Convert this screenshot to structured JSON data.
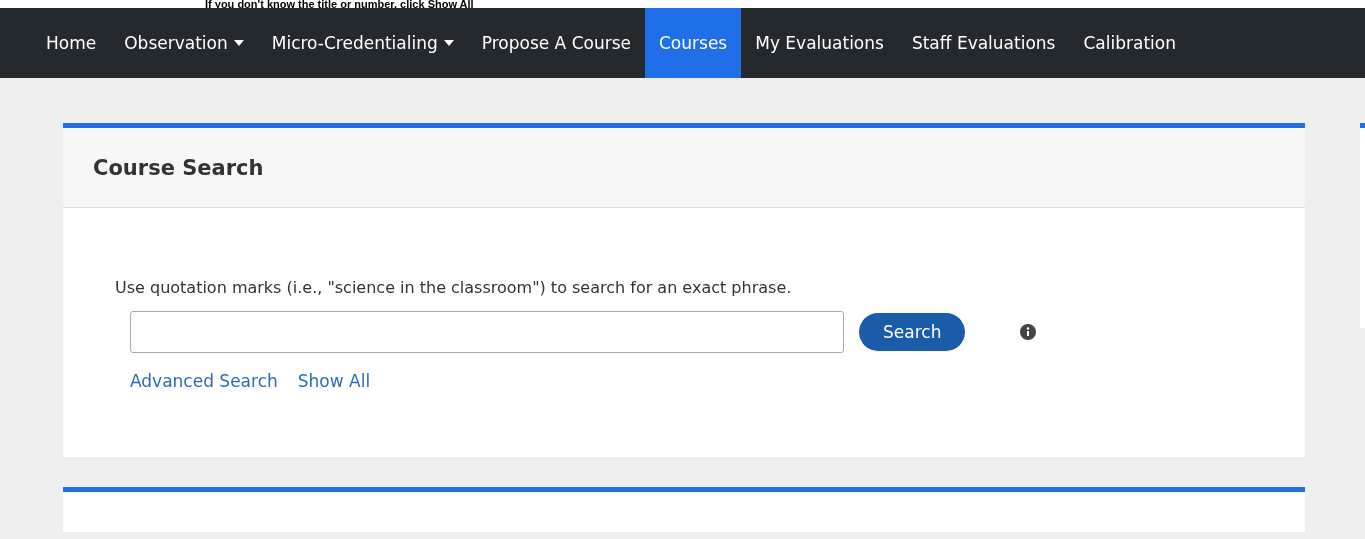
{
  "note": "If you don't know the title or number, click Show All",
  "nav": [
    {
      "label": "Home",
      "dropdown": false,
      "selected": false
    },
    {
      "label": "Observation",
      "dropdown": true,
      "selected": false
    },
    {
      "label": "Micro-Credentialing",
      "dropdown": true,
      "selected": false
    },
    {
      "label": "Propose A Course",
      "dropdown": false,
      "selected": false
    },
    {
      "label": "Courses",
      "dropdown": false,
      "selected": true
    },
    {
      "label": "My Evaluations",
      "dropdown": false,
      "selected": false
    },
    {
      "label": "Staff Evaluations",
      "dropdown": false,
      "selected": false
    },
    {
      "label": "Calibration",
      "dropdown": false,
      "selected": false
    }
  ],
  "card": {
    "title": "Course Search",
    "hint": "Use quotation marks (i.e., \"science in the classroom\") to search for an exact phrase.",
    "button": "Search",
    "links": [
      "Advanced Search",
      "Show All"
    ]
  }
}
